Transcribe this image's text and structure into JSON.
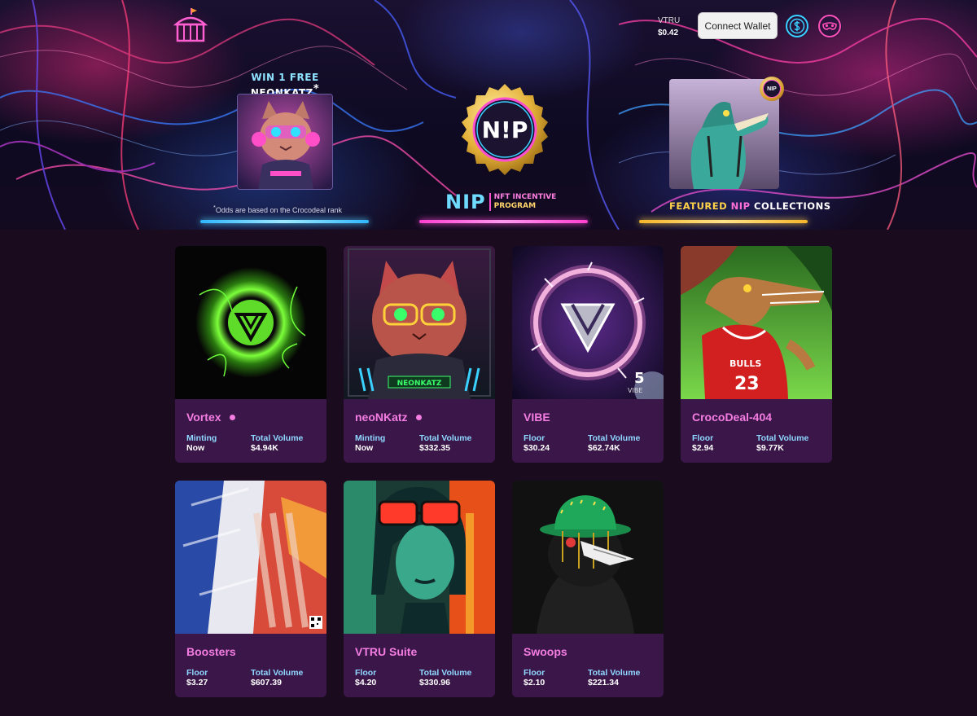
{
  "header": {
    "vtru_label": "VTRU",
    "vtru_price": "$0.42",
    "connect_label": "Connect Wallet"
  },
  "icons": {
    "logo": "circus-tent-icon",
    "currency": "dollar-circle-icon",
    "profile": "mask-icon"
  },
  "promos": {
    "win": {
      "title_prefix": "WIN 1 FREE ",
      "title_name": "NEONKATZ",
      "title_star": "*",
      "note_star": "*",
      "note": "Odds are based on the Crocodeal rank"
    },
    "nip": {
      "badge": "N!P",
      "word": "NIP",
      "line1": "NFT INCENTIVE",
      "line2": "PROGRAM"
    },
    "featured": {
      "badge": "NIP",
      "prefix": "FEATURED ",
      "highlight": "NIP",
      "suffix": " COLLECTIONS"
    }
  },
  "colors": {
    "accent_pink": "#f47de2",
    "stat_key": "#8ed8ff",
    "card_bg": "#3b1649",
    "underline_blue": "#4fd0ff",
    "underline_pink": "#ff4fd8",
    "underline_gold": "#f5c84a"
  },
  "collections": [
    {
      "name": "Vortex",
      "live": true,
      "k1": "Minting",
      "v1": "Now",
      "k2": "Total Volume",
      "v2": "$4.94K"
    },
    {
      "name": "neoNKatz",
      "live": true,
      "k1": "Minting",
      "v1": "Now",
      "k2": "Total Volume",
      "v2": "$332.35"
    },
    {
      "name": "VIBE",
      "live": false,
      "k1": "Floor",
      "v1": "$30.24",
      "k2": "Total Volume",
      "v2": "$62.74K"
    },
    {
      "name": "CrocoDeal-404",
      "live": false,
      "k1": "Floor",
      "v1": "$2.94",
      "k2": "Total Volume",
      "v2": "$9.77K"
    },
    {
      "name": "Boosters",
      "live": false,
      "k1": "Floor",
      "v1": "$3.27",
      "k2": "Total Volume",
      "v2": "$607.39"
    },
    {
      "name": "VTRU Suite",
      "live": false,
      "k1": "Floor",
      "v1": "$4.20",
      "k2": "Total Volume",
      "v2": "$330.96"
    },
    {
      "name": "Swoops",
      "live": false,
      "k1": "Floor",
      "v1": "$2.10",
      "k2": "Total Volume",
      "v2": "$221.34"
    }
  ],
  "art_text": {
    "neonkatz_plate": "NEONKATZ",
    "vibe_number": "5",
    "vibe_caption": "VIBE",
    "croc_jersey_team": "BULLS",
    "croc_jersey_number": "23"
  }
}
